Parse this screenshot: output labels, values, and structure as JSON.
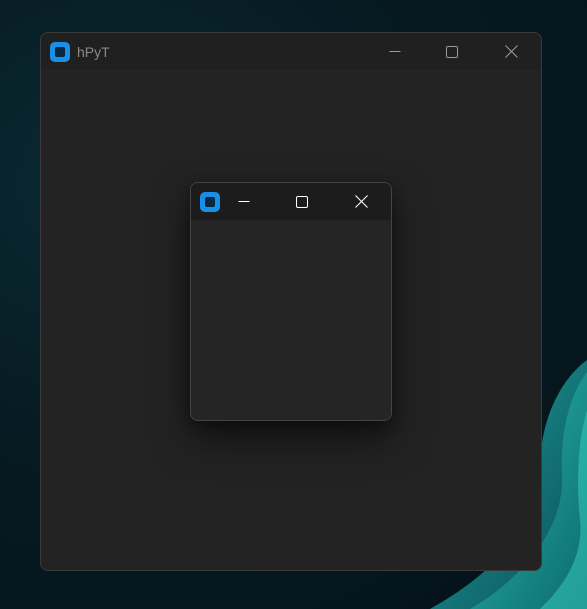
{
  "desktop": {
    "wallpaper_colors": {
      "background": "#061a22",
      "accent": "#1aa39a"
    }
  },
  "main_window": {
    "title": "hPyT",
    "icon": "app-icon",
    "controls": {
      "minimize_icon": "minimize-icon",
      "maximize_icon": "maximize-icon",
      "close_icon": "close-icon"
    },
    "colors": {
      "titlebar": "#202020",
      "content": "#232323",
      "title_text": "#8a8a8a",
      "control_glyph": "#9a9a9a"
    }
  },
  "child_window": {
    "title": "",
    "icon": "app-icon",
    "controls": {
      "minimize_icon": "minimize-icon",
      "maximize_icon": "maximize-icon",
      "close_icon": "close-icon"
    },
    "colors": {
      "titlebar": "#1c1c1c",
      "content": "#252525",
      "control_glyph": "#ffffff"
    }
  }
}
